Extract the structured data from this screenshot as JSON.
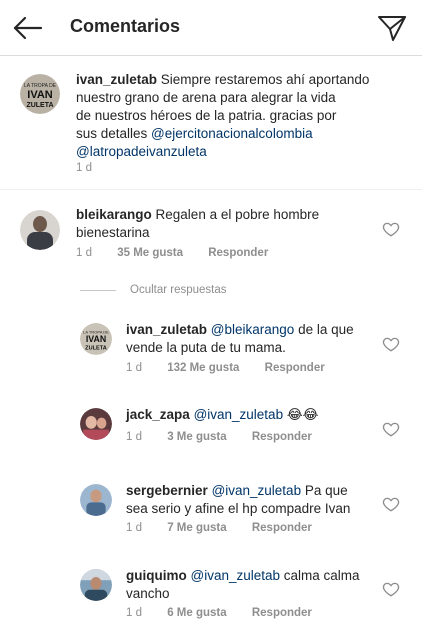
{
  "header": {
    "title": "Comentarios"
  },
  "caption": {
    "username": "ivan_zuletab",
    "text_1": " Siempre restaremos ahí aportando",
    "text_2": "nuestro  grano de arena para alegrar la vida",
    "text_3": "de nuestros héroes de la patria. gracias por",
    "text_4": "sus detalles ",
    "mention_1": "@ejercitonacionalcolombia",
    "mention_2": "@latropadeivanzuleta",
    "time": "1 d"
  },
  "comment": {
    "username": "bleikarango",
    "text_1": " Regalen a el pobre hombre",
    "text_2": "bienestarina",
    "time": "1 d",
    "likes": "35 Me gusta",
    "reply": "Responder"
  },
  "hide_replies": "Ocultar respuestas",
  "replies": [
    {
      "username": "ivan_zuletab",
      "mention": "@bleikarango",
      "text_1": " de la que",
      "text_2": "vende la puta de tu mama.",
      "time": "1 d",
      "likes": "132 Me gusta",
      "reply": "Responder"
    },
    {
      "username": "jack_zapa",
      "mention": "@ivan_zuletab",
      "text_1": " 😂😂",
      "time": "1 d",
      "likes": "3 Me gusta",
      "reply": "Responder"
    },
    {
      "username": "sergebernier",
      "mention": "@ivan_zuletab",
      "text_1": " Pa que",
      "text_2": "sea serio y afine el hp compadre Ivan",
      "time": "1 d",
      "likes": "7 Me gusta",
      "reply": "Responder"
    },
    {
      "username": "guiquimo",
      "mention": "@ivan_zuletab",
      "text_1": " calma calma",
      "text_2": "vancho",
      "time": "1 d",
      "likes": "6 Me gusta",
      "reply": "Responder"
    }
  ],
  "avatar_logo": {
    "line_1": "LA TROPA DE",
    "line_2": "IVAN",
    "line_3": "ZULETA"
  },
  "colors": {
    "text": "#262626",
    "mention": "#003569",
    "meta": "#8e8e8e",
    "divider": "#dbdbdb"
  },
  "icons": {
    "back": "back-arrow-icon",
    "send": "send-icon",
    "heart": "heart-outline-icon"
  }
}
